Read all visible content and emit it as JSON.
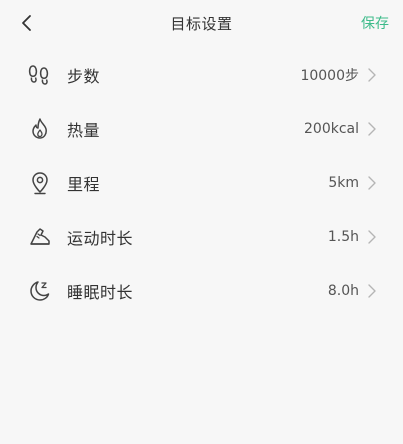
{
  "header": {
    "title": "目标设置",
    "save_label": "保存",
    "back_icon": "chevron-left-icon"
  },
  "goals": [
    {
      "label": "步数",
      "value": "10000步",
      "icon": "footprints-icon"
    },
    {
      "label": "热量",
      "value": "200kcal",
      "icon": "flame-icon"
    },
    {
      "label": "里程",
      "value": "5km",
      "icon": "location-pin-icon"
    },
    {
      "label": "运动时长",
      "value": "1.5h",
      "icon": "sneaker-icon"
    },
    {
      "label": "睡眠时长",
      "value": "8.0h",
      "icon": "moon-sleep-icon"
    }
  ],
  "colors": {
    "accent": "#3dbb8a",
    "background": "#f7f7f7",
    "text": "#333333",
    "chevron": "#b5b5b5"
  }
}
